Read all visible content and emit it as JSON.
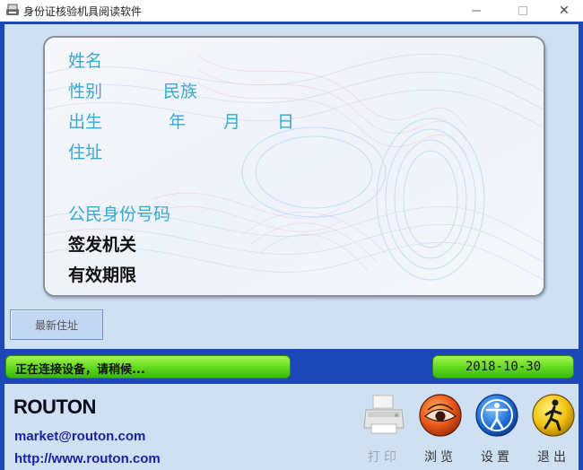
{
  "window": {
    "title": "身份证核验机具阅读软件",
    "minimize_icon": "minimize-icon",
    "maximize_icon": "maximize-icon",
    "close_icon": "close-icon",
    "close_glyph": "✕"
  },
  "id_card": {
    "name_label": "姓名",
    "gender_label": "性别",
    "ethnicity_label": "民族",
    "birth_label": "出生",
    "year_label": "年",
    "month_label": "月",
    "day_label": "日",
    "address_label": "住址",
    "id_number_label": "公民身份号码",
    "issuer_label": "签发机关",
    "validity_label": "有效期限"
  },
  "buttons": {
    "update_address": "最新住址"
  },
  "status": {
    "message": "正在连接设备，请稍候...",
    "date": "2018-10-30"
  },
  "footer": {
    "logo_text": "ROUTON",
    "email": "market@routon.com",
    "website": "http://www.routon.com"
  },
  "toolbar": {
    "print": {
      "label": "打印",
      "icon": "printer-icon",
      "enabled": false
    },
    "browse": {
      "label": "浏览",
      "icon": "eye-icon",
      "enabled": true
    },
    "settings": {
      "label": "设置",
      "icon": "accessibility-icon",
      "enabled": true
    },
    "exit": {
      "label": "退出",
      "icon": "exit-person-icon",
      "enabled": true
    }
  },
  "colors": {
    "frame": "#1c47b8",
    "panel": "#cfe0f3",
    "label_blue": "#37a9d2",
    "status_green": "#5fd81d"
  }
}
